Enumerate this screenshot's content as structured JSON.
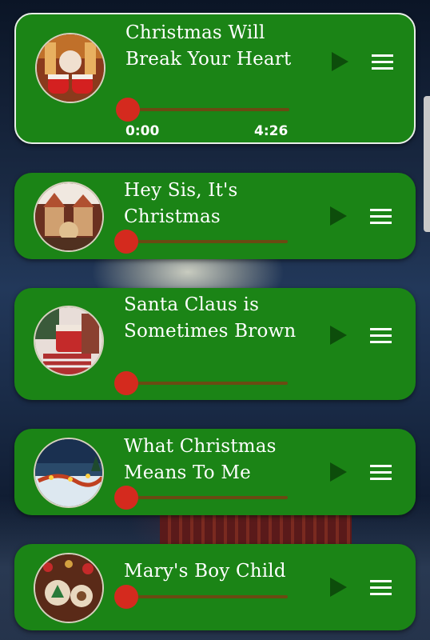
{
  "player": {
    "current_song": {
      "title": "Christmas Will Break Your Heart",
      "elapsed": "0:00",
      "duration": "4:26",
      "progress": 0
    }
  },
  "playlist": [
    {
      "title": "Christmas Will Break Your Heart",
      "active": true,
      "progress": 0
    },
    {
      "title": "Hey Sis, It's Christmas",
      "active": false,
      "progress": 0
    },
    {
      "title": "Santa Claus is Sometimes Brown",
      "active": false,
      "progress": 0
    },
    {
      "title": "What Christmas Means To Me",
      "active": false,
      "progress": 0
    },
    {
      "title": "Mary's Boy Child",
      "active": false,
      "progress": 0
    }
  ],
  "icons": {
    "play": "play-icon",
    "menu": "hamburger-menu-icon"
  },
  "colors": {
    "card": "#1b8416",
    "play_icon": "#0d4d0b",
    "seek_knob": "#d42a1e",
    "seek_track": "#6a4a12",
    "active_border": "#e8eee8"
  }
}
